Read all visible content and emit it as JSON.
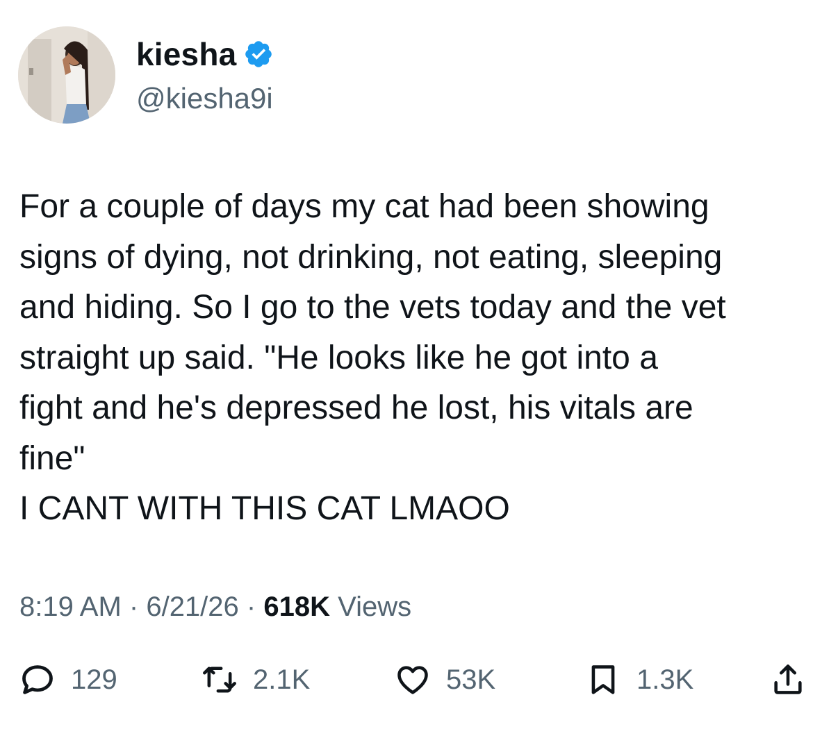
{
  "author": {
    "display_name": "kiesha",
    "handle": "@kiesha9i",
    "verified": true
  },
  "tweet": {
    "lines": [
      "For a couple of days my cat had been showing",
      "signs of dying, not drinking, not eating, sleeping",
      "and hiding. So I go to the vets today and the vet",
      "straight up said. \"He looks like he got into a",
      "fight and he's depressed he lost, his vitals are",
      "fine\"",
      "I CANT WITH THIS CAT LMAOO"
    ]
  },
  "meta": {
    "time": "8:19 AM",
    "separator": "·",
    "date": "6/21/26",
    "views_count": "618K",
    "views_label": "Views"
  },
  "actions": {
    "reply": {
      "icon": "reply-icon",
      "count": "129"
    },
    "retweet": {
      "icon": "retweet-icon",
      "count": "2.1K"
    },
    "like": {
      "icon": "heart-icon",
      "count": "53K"
    },
    "bookmark": {
      "icon": "bookmark-icon",
      "count": "1.3K"
    },
    "share": {
      "icon": "share-icon"
    }
  },
  "colors": {
    "text": "#0f1419",
    "muted": "#536471",
    "verified_blue": "#1d9bf0",
    "background": "#ffffff"
  }
}
